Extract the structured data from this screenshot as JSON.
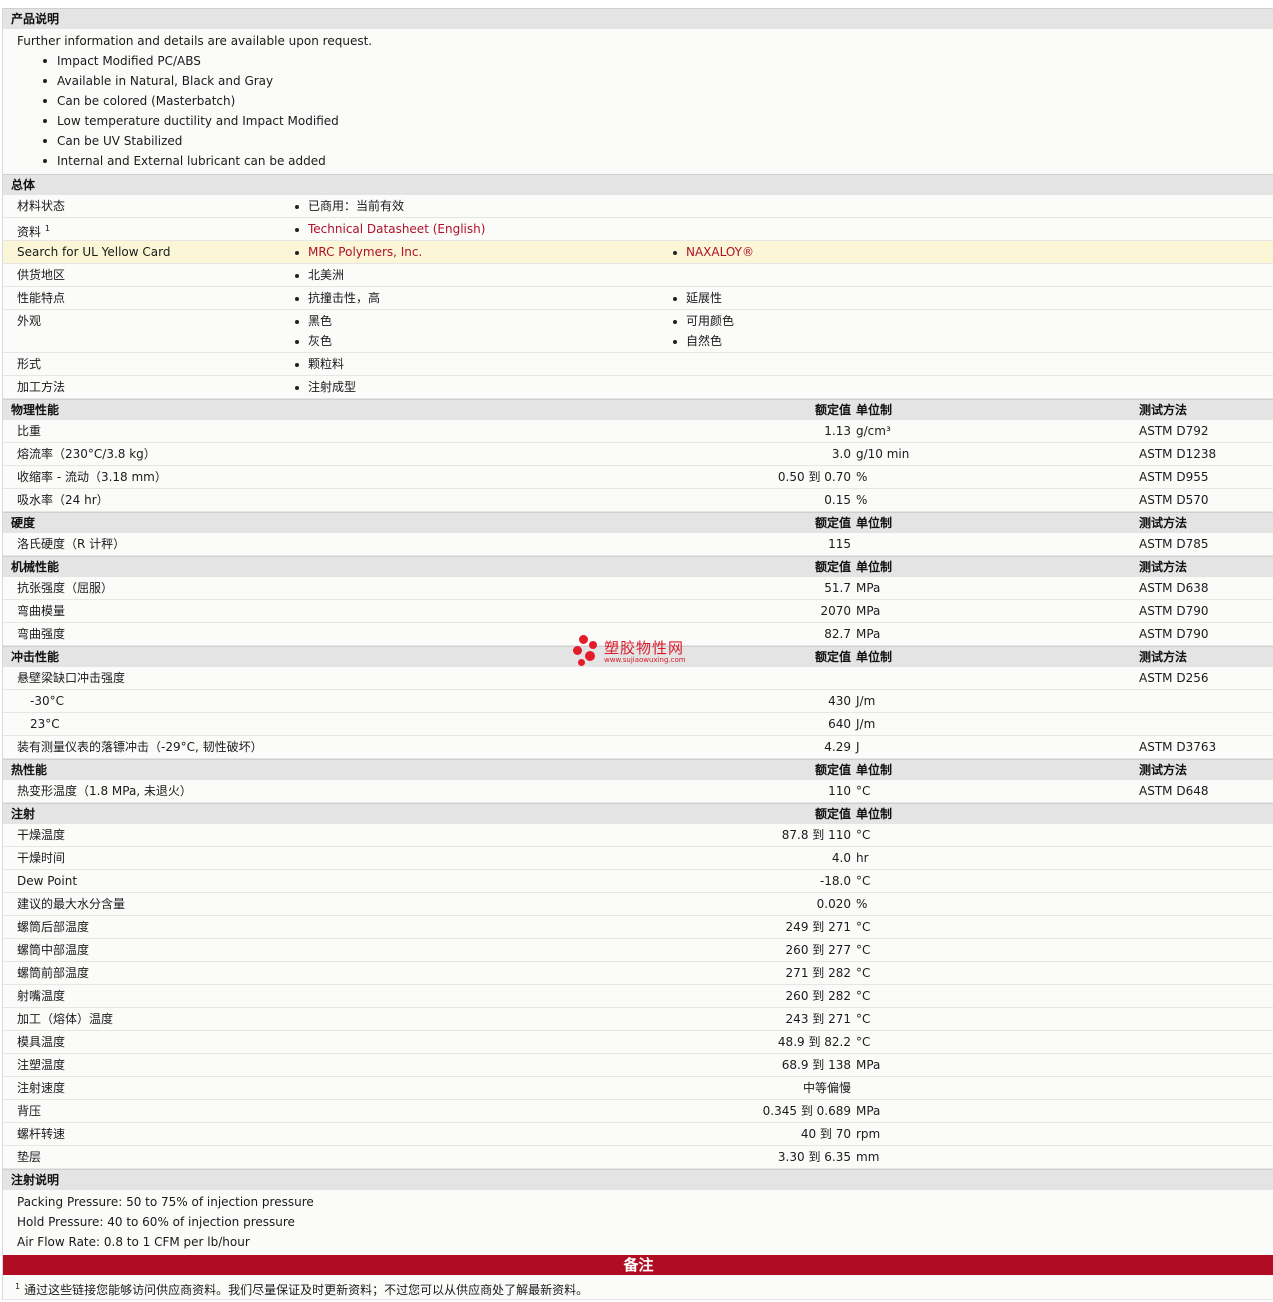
{
  "product_description": {
    "title": "产品说明",
    "intro": "Further information and details are available upon request.",
    "bullets": [
      "Impact Modified PC/ABS",
      "Available in Natural, Black and Gray",
      "Can be colored (Masterbatch)",
      "Low temperature ductility and Impact Modified",
      "Can be UV Stabilized",
      "Internal and External lubricant can be added"
    ]
  },
  "general": {
    "title": "总体",
    "material_status": {
      "label": "材料状态",
      "value": "已商用：当前有效"
    },
    "resources": {
      "label": "资料",
      "sup": "1",
      "value": "Technical Datasheet (English)"
    },
    "ul_card": {
      "label": "Search for UL Yellow Card",
      "value1": "MRC Polymers, Inc.",
      "value2": "NAXALOY®"
    },
    "region": {
      "label": "供货地区",
      "value": "北美洲"
    },
    "features": {
      "label": "性能特点",
      "value1": "抗撞击性，高",
      "value2": "延展性"
    },
    "appearance": {
      "label": "外观",
      "col1": [
        "黑色",
        "灰色"
      ],
      "col2": [
        "可用颜色",
        "自然色"
      ]
    },
    "form": {
      "label": "形式",
      "value": "颗粒料"
    },
    "processing": {
      "label": "加工方法",
      "value": "注射成型"
    }
  },
  "headers": {
    "nominal": "额定值",
    "unit": "单位制",
    "method": "测试方法"
  },
  "physical": {
    "title": "物理性能",
    "rows": [
      {
        "label": "比重",
        "value": "1.13",
        "unit": "g/cm³",
        "method": "ASTM D792"
      },
      {
        "label": "熔流率（230°C/3.8 kg）",
        "value": "3.0",
        "unit": "g/10 min",
        "method": "ASTM D1238"
      },
      {
        "label": "收缩率 - 流动（3.18 mm）",
        "value": "0.50 到  0.70",
        "unit": "%",
        "method": "ASTM D955"
      },
      {
        "label": "吸水率（24 hr）",
        "value": "0.15",
        "unit": "%",
        "method": "ASTM D570"
      }
    ]
  },
  "hardness": {
    "title": "硬度",
    "rows": [
      {
        "label": "洛氏硬度（R 计秤）",
        "value": "115",
        "unit": "",
        "method": "ASTM D785"
      }
    ]
  },
  "mechanical": {
    "title": "机械性能",
    "rows": [
      {
        "label": "抗张强度（屈服）",
        "value": "51.7",
        "unit": "MPa",
        "method": "ASTM D638"
      },
      {
        "label": "弯曲模量",
        "value": "2070",
        "unit": "MPa",
        "method": "ASTM D790"
      },
      {
        "label": "弯曲强度",
        "value": "82.7",
        "unit": "MPa",
        "method": "ASTM D790"
      }
    ]
  },
  "impact": {
    "title": "冲击性能",
    "izod": {
      "label": "悬壁梁缺口冲击强度",
      "method": "ASTM D256"
    },
    "izod_rows": [
      {
        "label": "-30°C",
        "value": "430",
        "unit": "J/m"
      },
      {
        "label": "23°C",
        "value": "640",
        "unit": "J/m"
      }
    ],
    "dart": {
      "label": "装有测量仪表的落镖冲击（-29°C, 韧性破坏）",
      "value": "4.29",
      "unit": "J",
      "method": "ASTM D3763"
    }
  },
  "thermal": {
    "title": "热性能",
    "rows": [
      {
        "label": "热变形温度（1.8 MPa, 未退火）",
        "value": "110",
        "unit": "°C",
        "method": "ASTM D648"
      }
    ]
  },
  "injection": {
    "title": "注射",
    "rows": [
      {
        "label": "干燥温度",
        "value": "87.8 到  110",
        "unit": "°C"
      },
      {
        "label": "干燥时间",
        "value": "4.0",
        "unit": "hr"
      },
      {
        "label": "Dew Point",
        "value": "-18.0",
        "unit": "°C"
      },
      {
        "label": "建议的最大水分含量",
        "value": "0.020",
        "unit": "%"
      },
      {
        "label": "螺筒后部温度",
        "value": "249 到  271",
        "unit": "°C"
      },
      {
        "label": "螺筒中部温度",
        "value": "260 到  277",
        "unit": "°C"
      },
      {
        "label": "螺筒前部温度",
        "value": "271 到  282",
        "unit": "°C"
      },
      {
        "label": "射嘴温度",
        "value": "260 到  282",
        "unit": "°C"
      },
      {
        "label": "加工（熔体）温度",
        "value": "243 到  271",
        "unit": "°C"
      },
      {
        "label": "模具温度",
        "value": "48.9 到  82.2",
        "unit": "°C"
      },
      {
        "label": "注塑温度",
        "value": "68.9 到  138",
        "unit": "MPa"
      },
      {
        "label": "注射速度",
        "value": "中等偏慢",
        "unit": ""
      },
      {
        "label": "背压",
        "value": "0.345 到  0.689",
        "unit": "MPa"
      },
      {
        "label": "螺杆转速",
        "value": "40 到  70",
        "unit": "rpm"
      },
      {
        "label": "垫层",
        "value": "3.30 到  6.35",
        "unit": "mm"
      }
    ]
  },
  "injection_notes": {
    "title": "注射说明",
    "lines": [
      "Packing Pressure: 50 to 75% of injection pressure",
      "Hold Pressure: 40 to 60% of injection pressure",
      "Air Flow Rate: 0.8 to 1 CFM per lb/hour"
    ]
  },
  "remarks": {
    "title": "备注",
    "footnote_sup": "1",
    "footnote": "通过这些链接您能够访问供应商资料。我们尽量保证及时更新资料；不过您可以从供应商处了解最新资料。"
  },
  "watermark": {
    "text": "塑胶物性网",
    "url": "www.sujiaowuxing.com"
  },
  "colors": {
    "link": "#b0102a",
    "notes_bar": "#b10d22",
    "section_bg": "#e4e4e4",
    "highlight_row": "#fbf7d6"
  }
}
